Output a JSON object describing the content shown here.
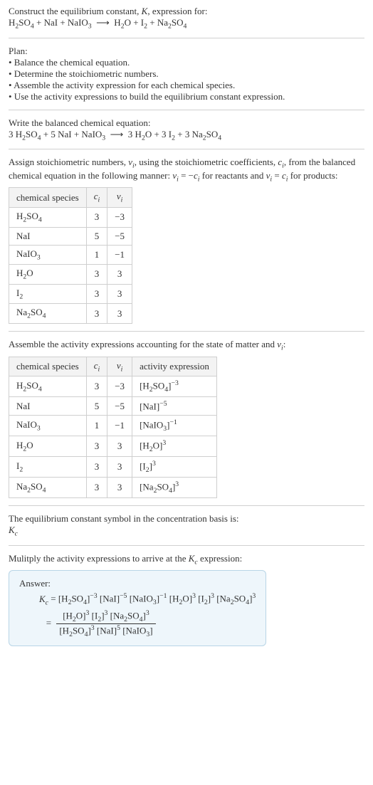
{
  "title_line1": "Construct the equilibrium constant, K, expression for:",
  "title_eq": "H₂SO₄ + NaI + NaIO₃ ⟶ H₂O + I₂ + Na₂SO₄",
  "plan_header": "Plan:",
  "plan_items": [
    "• Balance the chemical equation.",
    "• Determine the stoichiometric numbers.",
    "• Assemble the activity expression for each chemical species.",
    "• Use the activity expressions to build the equilibrium constant expression."
  ],
  "balanced_header": "Write the balanced chemical equation:",
  "balanced_eq": "3 H₂SO₄ + 5 NaI + NaIO₃ ⟶ 3 H₂O + 3 I₂ + 3 Na₂SO₄",
  "stoich_intro_1": "Assign stoichiometric numbers, νᵢ, using the stoichiometric coefficients, cᵢ, from the balanced chemical equation in the following manner: νᵢ = −cᵢ for reactants and νᵢ = cᵢ for products:",
  "table1_headers": [
    "chemical species",
    "cᵢ",
    "νᵢ"
  ],
  "table1_rows": [
    {
      "sp": "H₂SO₄",
      "c": "3",
      "v": "−3"
    },
    {
      "sp": "NaI",
      "c": "5",
      "v": "−5"
    },
    {
      "sp": "NaIO₃",
      "c": "1",
      "v": "−1"
    },
    {
      "sp": "H₂O",
      "c": "3",
      "v": "3"
    },
    {
      "sp": "I₂",
      "c": "3",
      "v": "3"
    },
    {
      "sp": "Na₂SO₄",
      "c": "3",
      "v": "3"
    }
  ],
  "assemble_intro": "Assemble the activity expressions accounting for the state of matter and νᵢ:",
  "table2_headers": [
    "chemical species",
    "cᵢ",
    "νᵢ",
    "activity expression"
  ],
  "table2_rows": [
    {
      "sp": "H₂SO₄",
      "c": "3",
      "v": "−3",
      "ae": "[H₂SO₄]⁻³"
    },
    {
      "sp": "NaI",
      "c": "5",
      "v": "−5",
      "ae": "[NaI]⁻⁵"
    },
    {
      "sp": "NaIO₃",
      "c": "1",
      "v": "−1",
      "ae": "[NaIO₃]⁻¹"
    },
    {
      "sp": "H₂O",
      "c": "3",
      "v": "3",
      "ae": "[H₂O]³"
    },
    {
      "sp": "I₂",
      "c": "3",
      "v": "3",
      "ae": "[I₂]³"
    },
    {
      "sp": "Na₂SO₄",
      "c": "3",
      "v": "3",
      "ae": "[Na₂SO₄]³"
    }
  ],
  "eq_const_line1": "The equilibrium constant symbol in the concentration basis is:",
  "eq_const_symbol": "K_c",
  "multiply_line": "Mulitply the activity expressions to arrive at the K_c expression:",
  "answer_label": "Answer:",
  "answer_line1": "K_c = [H₂SO₄]⁻³ [NaI]⁻⁵ [NaIO₃]⁻¹ [H₂O]³ [I₂]³ [Na₂SO₄]³",
  "answer_equals": "=",
  "answer_num": "[H₂O]³ [I₂]³ [Na₂SO₄]³",
  "answer_den": "[H₂SO₄]³ [NaI]⁵ [NaIO₃]"
}
